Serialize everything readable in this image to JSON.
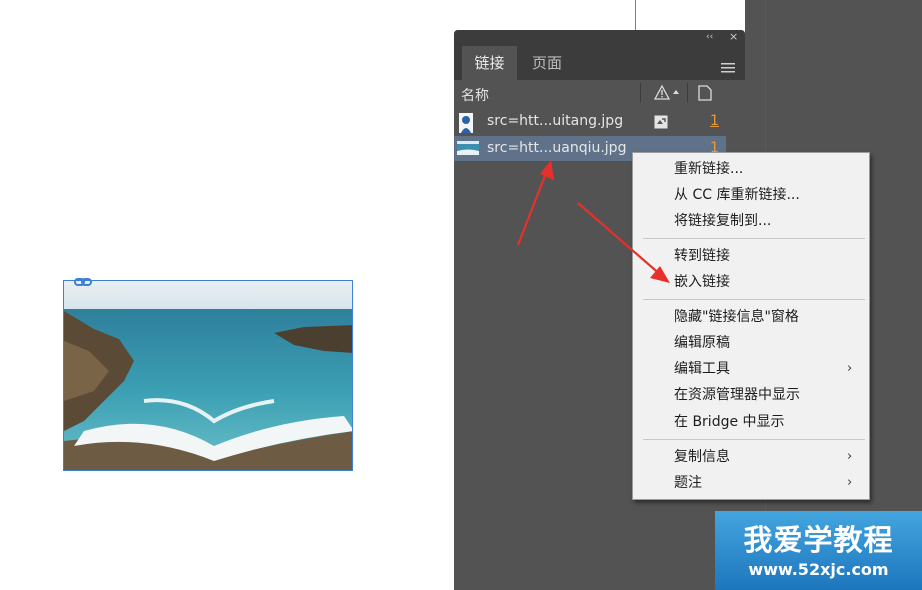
{
  "panel": {
    "collapse_glyph": "‹‹",
    "close_glyph": "×",
    "tabs": [
      {
        "label": "链接",
        "active": true
      },
      {
        "label": "页面",
        "active": false
      }
    ],
    "column_name": "名称",
    "links": [
      {
        "name": "src=htt...uitang.jpg",
        "page": "1",
        "icon": "portrait-thumbnail"
      },
      {
        "name": "src=htt...uanqiu.jpg",
        "page": "1",
        "icon": "seascape-thumbnail",
        "selected": true
      }
    ]
  },
  "context_menu": {
    "groups": [
      [
        {
          "label": "重新链接..."
        },
        {
          "label": "从 CC 库重新链接..."
        },
        {
          "label": "将链接复制到..."
        }
      ],
      [
        {
          "label": "转到链接"
        },
        {
          "label": "嵌入链接"
        }
      ],
      [
        {
          "label": "隐藏\"链接信息\"窗格"
        },
        {
          "label": "编辑原稿"
        },
        {
          "label": "编辑工具",
          "submenu": true
        },
        {
          "label": "在资源管理器中显示"
        },
        {
          "label": "在 Bridge 中显示"
        }
      ],
      [
        {
          "label": "复制信息",
          "submenu": true
        },
        {
          "label": "题注",
          "submenu": true
        }
      ]
    ]
  },
  "watermark": {
    "title": "我爱学教程",
    "url": "www.52xjc.com"
  },
  "colors": {
    "panel_bg": "#535353",
    "selected_row": "#60728a",
    "page_number": "#e99b3b",
    "frame_border": "#3d7fd3",
    "arrow": "#e8302a",
    "watermark": "#2f8fd3"
  }
}
